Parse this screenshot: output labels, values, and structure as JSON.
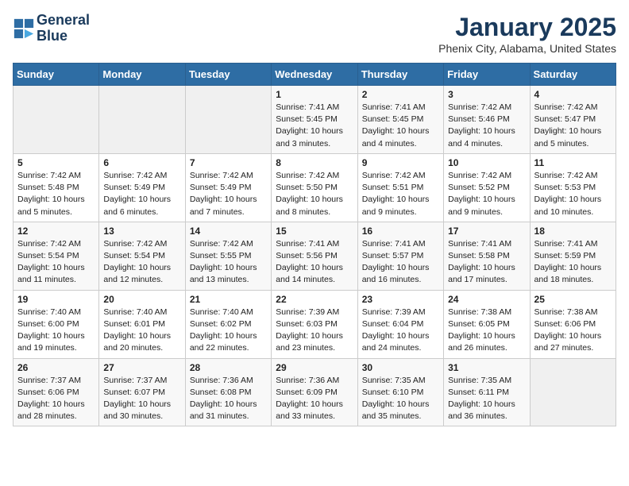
{
  "header": {
    "logo_line1": "General",
    "logo_line2": "Blue",
    "month": "January 2025",
    "location": "Phenix City, Alabama, United States"
  },
  "weekdays": [
    "Sunday",
    "Monday",
    "Tuesday",
    "Wednesday",
    "Thursday",
    "Friday",
    "Saturday"
  ],
  "weeks": [
    [
      {
        "day": "",
        "sunrise": "",
        "sunset": "",
        "daylight": ""
      },
      {
        "day": "",
        "sunrise": "",
        "sunset": "",
        "daylight": ""
      },
      {
        "day": "",
        "sunrise": "",
        "sunset": "",
        "daylight": ""
      },
      {
        "day": "1",
        "sunrise": "Sunrise: 7:41 AM",
        "sunset": "Sunset: 5:45 PM",
        "daylight": "Daylight: 10 hours and 3 minutes."
      },
      {
        "day": "2",
        "sunrise": "Sunrise: 7:41 AM",
        "sunset": "Sunset: 5:45 PM",
        "daylight": "Daylight: 10 hours and 4 minutes."
      },
      {
        "day": "3",
        "sunrise": "Sunrise: 7:42 AM",
        "sunset": "Sunset: 5:46 PM",
        "daylight": "Daylight: 10 hours and 4 minutes."
      },
      {
        "day": "4",
        "sunrise": "Sunrise: 7:42 AM",
        "sunset": "Sunset: 5:47 PM",
        "daylight": "Daylight: 10 hours and 5 minutes."
      }
    ],
    [
      {
        "day": "5",
        "sunrise": "Sunrise: 7:42 AM",
        "sunset": "Sunset: 5:48 PM",
        "daylight": "Daylight: 10 hours and 5 minutes."
      },
      {
        "day": "6",
        "sunrise": "Sunrise: 7:42 AM",
        "sunset": "Sunset: 5:49 PM",
        "daylight": "Daylight: 10 hours and 6 minutes."
      },
      {
        "day": "7",
        "sunrise": "Sunrise: 7:42 AM",
        "sunset": "Sunset: 5:49 PM",
        "daylight": "Daylight: 10 hours and 7 minutes."
      },
      {
        "day": "8",
        "sunrise": "Sunrise: 7:42 AM",
        "sunset": "Sunset: 5:50 PM",
        "daylight": "Daylight: 10 hours and 8 minutes."
      },
      {
        "day": "9",
        "sunrise": "Sunrise: 7:42 AM",
        "sunset": "Sunset: 5:51 PM",
        "daylight": "Daylight: 10 hours and 9 minutes."
      },
      {
        "day": "10",
        "sunrise": "Sunrise: 7:42 AM",
        "sunset": "Sunset: 5:52 PM",
        "daylight": "Daylight: 10 hours and 9 minutes."
      },
      {
        "day": "11",
        "sunrise": "Sunrise: 7:42 AM",
        "sunset": "Sunset: 5:53 PM",
        "daylight": "Daylight: 10 hours and 10 minutes."
      }
    ],
    [
      {
        "day": "12",
        "sunrise": "Sunrise: 7:42 AM",
        "sunset": "Sunset: 5:54 PM",
        "daylight": "Daylight: 10 hours and 11 minutes."
      },
      {
        "day": "13",
        "sunrise": "Sunrise: 7:42 AM",
        "sunset": "Sunset: 5:54 PM",
        "daylight": "Daylight: 10 hours and 12 minutes."
      },
      {
        "day": "14",
        "sunrise": "Sunrise: 7:42 AM",
        "sunset": "Sunset: 5:55 PM",
        "daylight": "Daylight: 10 hours and 13 minutes."
      },
      {
        "day": "15",
        "sunrise": "Sunrise: 7:41 AM",
        "sunset": "Sunset: 5:56 PM",
        "daylight": "Daylight: 10 hours and 14 minutes."
      },
      {
        "day": "16",
        "sunrise": "Sunrise: 7:41 AM",
        "sunset": "Sunset: 5:57 PM",
        "daylight": "Daylight: 10 hours and 16 minutes."
      },
      {
        "day": "17",
        "sunrise": "Sunrise: 7:41 AM",
        "sunset": "Sunset: 5:58 PM",
        "daylight": "Daylight: 10 hours and 17 minutes."
      },
      {
        "day": "18",
        "sunrise": "Sunrise: 7:41 AM",
        "sunset": "Sunset: 5:59 PM",
        "daylight": "Daylight: 10 hours and 18 minutes."
      }
    ],
    [
      {
        "day": "19",
        "sunrise": "Sunrise: 7:40 AM",
        "sunset": "Sunset: 6:00 PM",
        "daylight": "Daylight: 10 hours and 19 minutes."
      },
      {
        "day": "20",
        "sunrise": "Sunrise: 7:40 AM",
        "sunset": "Sunset: 6:01 PM",
        "daylight": "Daylight: 10 hours and 20 minutes."
      },
      {
        "day": "21",
        "sunrise": "Sunrise: 7:40 AM",
        "sunset": "Sunset: 6:02 PM",
        "daylight": "Daylight: 10 hours and 22 minutes."
      },
      {
        "day": "22",
        "sunrise": "Sunrise: 7:39 AM",
        "sunset": "Sunset: 6:03 PM",
        "daylight": "Daylight: 10 hours and 23 minutes."
      },
      {
        "day": "23",
        "sunrise": "Sunrise: 7:39 AM",
        "sunset": "Sunset: 6:04 PM",
        "daylight": "Daylight: 10 hours and 24 minutes."
      },
      {
        "day": "24",
        "sunrise": "Sunrise: 7:38 AM",
        "sunset": "Sunset: 6:05 PM",
        "daylight": "Daylight: 10 hours and 26 minutes."
      },
      {
        "day": "25",
        "sunrise": "Sunrise: 7:38 AM",
        "sunset": "Sunset: 6:06 PM",
        "daylight": "Daylight: 10 hours and 27 minutes."
      }
    ],
    [
      {
        "day": "26",
        "sunrise": "Sunrise: 7:37 AM",
        "sunset": "Sunset: 6:06 PM",
        "daylight": "Daylight: 10 hours and 28 minutes."
      },
      {
        "day": "27",
        "sunrise": "Sunrise: 7:37 AM",
        "sunset": "Sunset: 6:07 PM",
        "daylight": "Daylight: 10 hours and 30 minutes."
      },
      {
        "day": "28",
        "sunrise": "Sunrise: 7:36 AM",
        "sunset": "Sunset: 6:08 PM",
        "daylight": "Daylight: 10 hours and 31 minutes."
      },
      {
        "day": "29",
        "sunrise": "Sunrise: 7:36 AM",
        "sunset": "Sunset: 6:09 PM",
        "daylight": "Daylight: 10 hours and 33 minutes."
      },
      {
        "day": "30",
        "sunrise": "Sunrise: 7:35 AM",
        "sunset": "Sunset: 6:10 PM",
        "daylight": "Daylight: 10 hours and 35 minutes."
      },
      {
        "day": "31",
        "sunrise": "Sunrise: 7:35 AM",
        "sunset": "Sunset: 6:11 PM",
        "daylight": "Daylight: 10 hours and 36 minutes."
      },
      {
        "day": "",
        "sunrise": "",
        "sunset": "",
        "daylight": ""
      }
    ]
  ]
}
